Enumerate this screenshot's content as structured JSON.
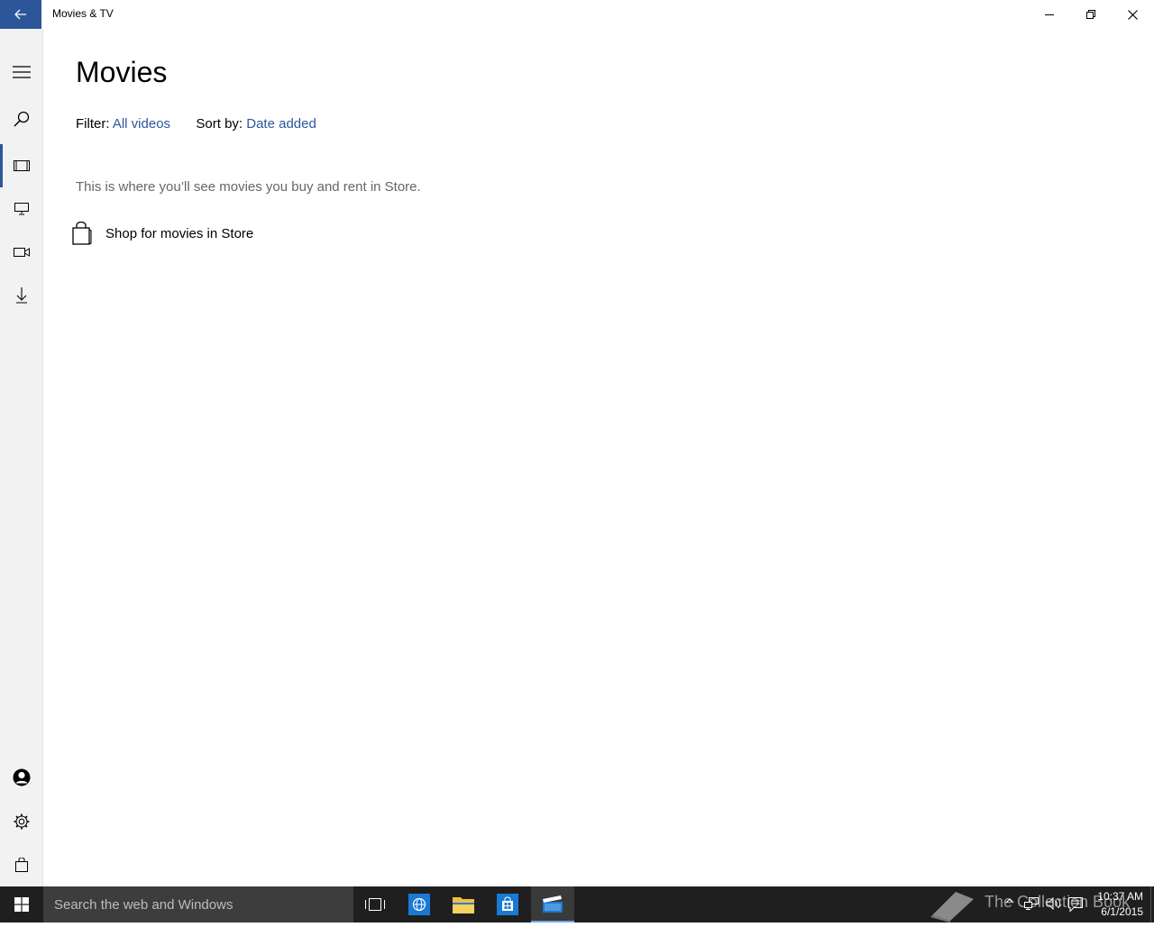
{
  "window": {
    "title": "Movies & TV"
  },
  "sidebar": {
    "items": [
      {
        "name": "menu",
        "icon": "hamburger-icon"
      },
      {
        "name": "search",
        "icon": "search-icon"
      },
      {
        "name": "movies",
        "icon": "film-icon",
        "selected": true
      },
      {
        "name": "tv",
        "icon": "tv-icon"
      },
      {
        "name": "videos",
        "icon": "video-camera-icon"
      },
      {
        "name": "downloads",
        "icon": "download-icon"
      }
    ],
    "bottom_items": [
      {
        "name": "account",
        "icon": "account-icon"
      },
      {
        "name": "settings",
        "icon": "gear-icon"
      },
      {
        "name": "store",
        "icon": "shopping-bag-icon"
      }
    ]
  },
  "main": {
    "title": "Movies",
    "filter_label": "Filter:",
    "filter_value": "All videos",
    "sort_label": "Sort by:",
    "sort_value": "Date added",
    "empty_message": "This is where you’ll see movies you buy and rent in Store.",
    "shop_link": "Shop for movies in Store"
  },
  "taskbar": {
    "search_placeholder": "Search the web and Windows",
    "apps": [
      "task-view-icon",
      "edge-icon",
      "file-explorer-icon",
      "store-icon",
      "movies-tv-icon"
    ],
    "active_app": "movies-tv-icon",
    "watermark": "The Collection Book",
    "time": "10:37 AM",
    "date": "6/1/2015"
  },
  "colors": {
    "accent": "#2b579a",
    "taskbar": "#1f1f1f",
    "sidebar": "#f2f2f2"
  }
}
